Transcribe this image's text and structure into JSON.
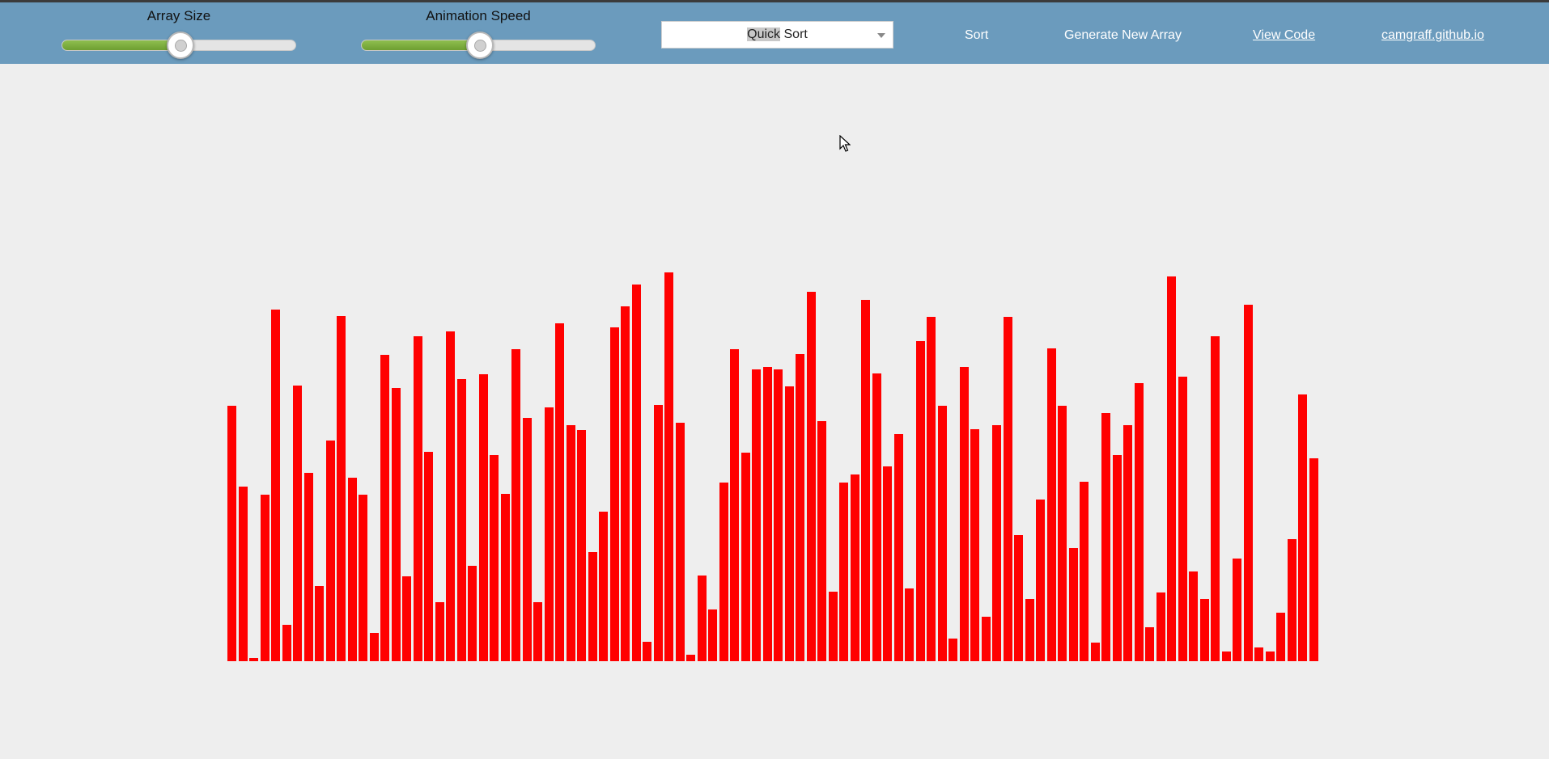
{
  "navbar": {
    "array_size": {
      "label": "Array Size",
      "value": 0.5
    },
    "animation_speed": {
      "label": "Animation Speed",
      "value": 0.5
    },
    "algorithm_select": {
      "selected_prefix": "Quick",
      "selected_suffix": " Sort",
      "icon": "chevron-down-icon"
    },
    "sort_label": "Sort",
    "generate_label": "Generate New Array",
    "view_code_label": "View Code",
    "site_link_label": "camgraff.github.io"
  },
  "colors": {
    "navbar": "#6b9bbd",
    "bar": "#ff0000",
    "background": "#eeeeee",
    "slider_fill": "#7aab3b"
  },
  "bars": [
    316,
    216,
    4,
    206,
    435,
    45,
    341,
    233,
    93,
    273,
    427,
    227,
    206,
    35,
    379,
    338,
    105,
    402,
    259,
    73,
    408,
    349,
    118,
    355,
    255,
    207,
    386,
    301,
    73,
    314,
    418,
    292,
    286,
    135,
    185,
    413,
    439,
    466,
    24,
    317,
    481,
    295,
    8,
    106,
    64,
    221,
    386,
    258,
    361,
    364,
    361,
    340,
    380,
    457,
    297,
    86,
    221,
    231,
    447,
    356,
    241,
    281,
    90,
    396,
    426,
    316,
    28,
    364,
    287,
    55,
    292,
    426,
    156,
    77,
    200,
    387,
    316,
    140,
    222,
    23,
    307,
    255,
    292,
    344,
    42,
    85,
    476,
    352,
    111,
    77,
    402,
    12,
    127,
    441,
    17,
    12,
    60,
    151,
    330,
    251
  ]
}
